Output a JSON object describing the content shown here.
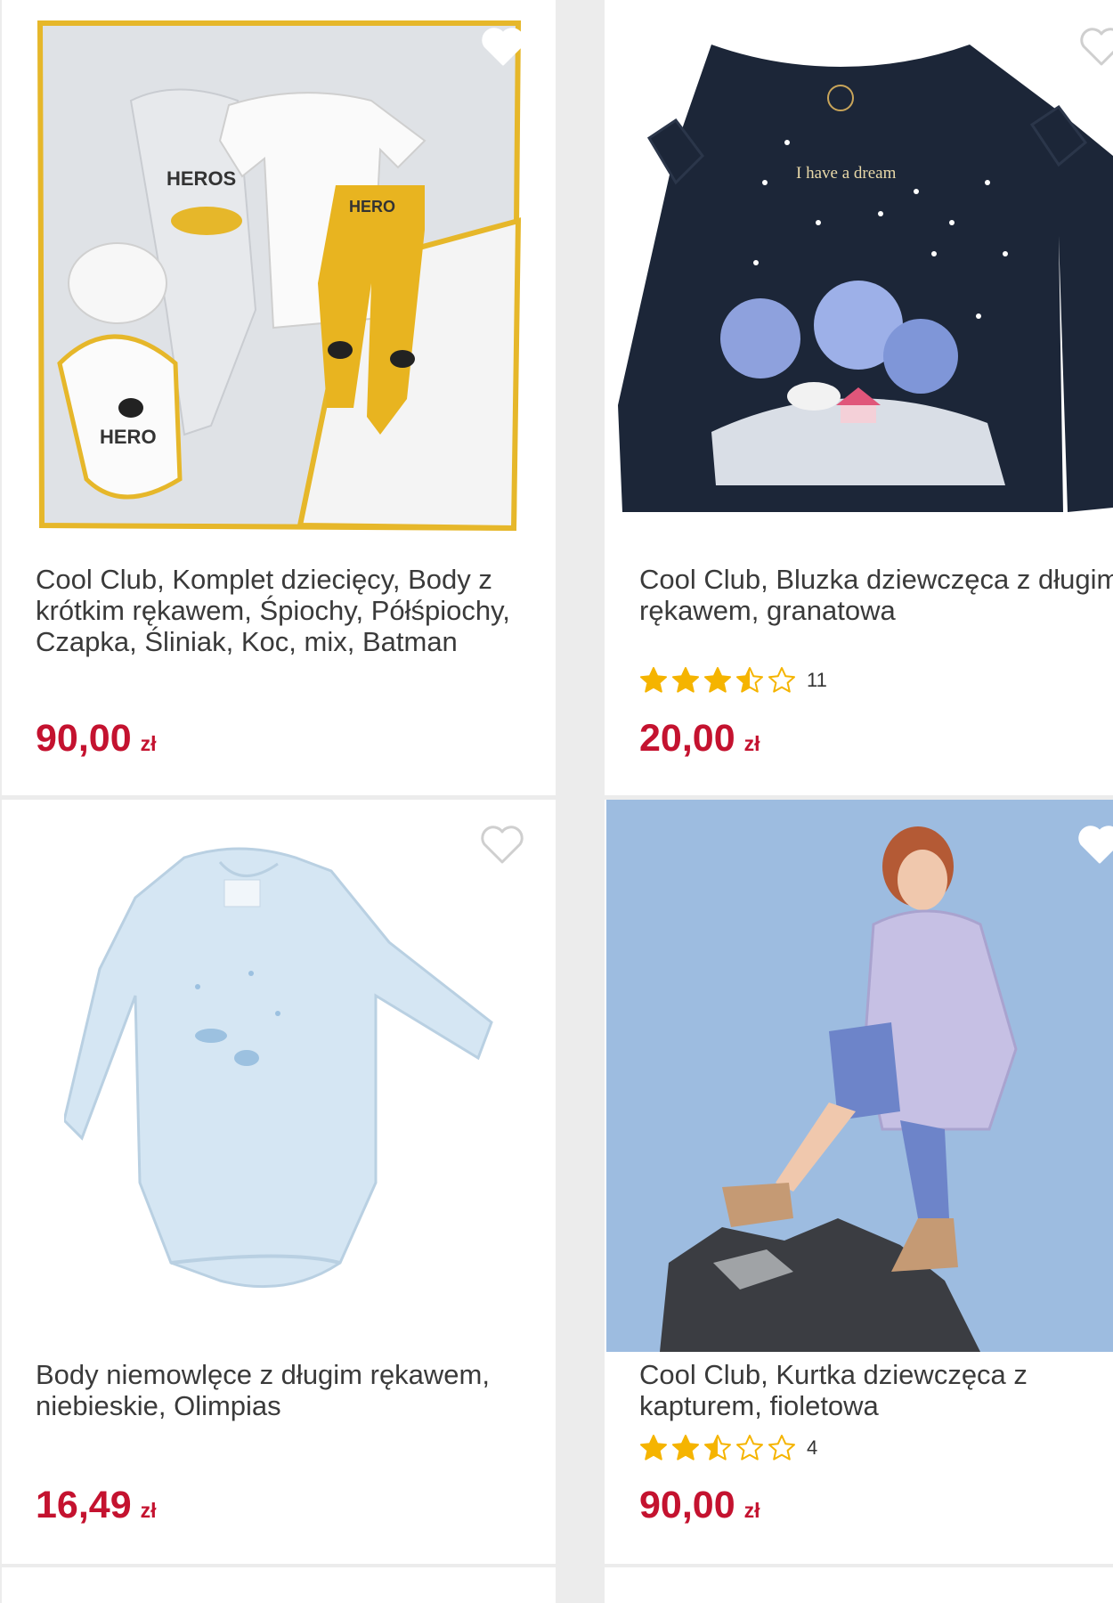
{
  "currency_label": "zł",
  "colors": {
    "price": "#c4122f",
    "star": "#f5b400",
    "title": "#3a3a3a"
  },
  "products": [
    {
      "title": "Cool Club, Komplet dziecięcy, Body z krótkim rękawem, Śpiochy, Półśpiochy, Czapka, Śliniak, Koc, mix, Batman",
      "price": "90,00",
      "image_icon": "batman-baby-set-image",
      "favorite_icon": "heart-icon"
    },
    {
      "title": "Cool Club, Bluzka dziewczęca z długim rękawem, granatowa",
      "price": "20,00",
      "rating": 3.5,
      "rating_count": "11",
      "image_icon": "navy-long-sleeve-top-image",
      "image_text": "I have a dream",
      "favorite_icon": "heart-icon"
    },
    {
      "title": "Body niemowlęce z długim rękawem, niebieskie, Olimpias",
      "price": "16,49",
      "image_icon": "light-blue-bodysuit-image",
      "favorite_icon": "heart-icon"
    },
    {
      "title": "Cool Club, Kurtka dziewczęca z kapturem, fioletowa",
      "price": "90,00",
      "rating": 2.5,
      "rating_count": "4",
      "image_icon": "girl-purple-jacket-image",
      "favorite_icon": "heart-icon"
    }
  ]
}
